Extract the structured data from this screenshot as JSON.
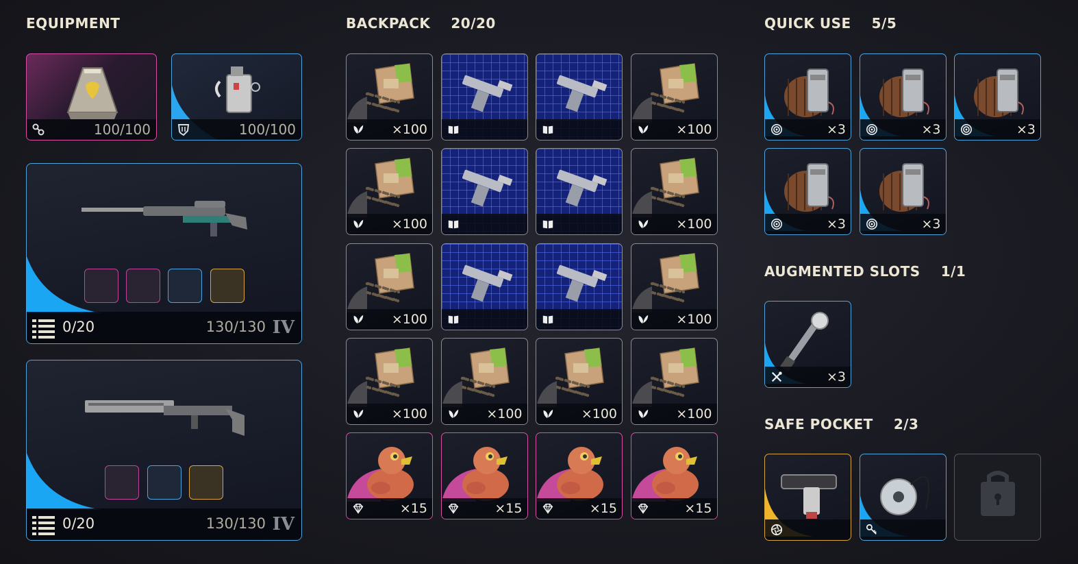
{
  "sections": {
    "equipment": {
      "title": "EQUIPMENT"
    },
    "backpack": {
      "title": "BACKPACK",
      "count": "20/20"
    },
    "quick_use": {
      "title": "QUICK USE",
      "count": "5/5"
    },
    "augmented": {
      "title": "AUGMENTED SLOTS",
      "count": "1/1"
    },
    "safe_pocket": {
      "title": "SAFE POCKET",
      "count": "2/3"
    }
  },
  "equipment": {
    "augment": {
      "value": "100/100",
      "icon": "augment-icon",
      "rarity_color": "#d850a6"
    },
    "shield": {
      "value": "100/100",
      "icon": "shield-icon",
      "rarity_color": "#2aa6f0"
    }
  },
  "weapons": [
    {
      "name": "sniper-rifle",
      "ammo": "0/20",
      "durability": "130/130",
      "tier": "IV",
      "attachments": [
        "pink",
        "pink",
        "blue",
        "gold"
      ]
    },
    {
      "name": "long-rifle",
      "ammo": "0/20",
      "durability": "130/130",
      "tier": "IV",
      "attachments": [
        "pink",
        "blue",
        "gold"
      ]
    }
  ],
  "backpack": [
    {
      "kind": "seeds",
      "qty": "×100",
      "icon": "leaf-icon"
    },
    {
      "kind": "blueprint",
      "qty": "",
      "icon": "book-icon"
    },
    {
      "kind": "blueprint",
      "qty": "",
      "icon": "book-icon"
    },
    {
      "kind": "seeds",
      "qty": "×100",
      "icon": "leaf-icon"
    },
    {
      "kind": "seeds",
      "qty": "×100",
      "icon": "leaf-icon"
    },
    {
      "kind": "blueprint",
      "qty": "",
      "icon": "book-icon"
    },
    {
      "kind": "blueprint",
      "qty": "",
      "icon": "book-icon"
    },
    {
      "kind": "seeds",
      "qty": "×100",
      "icon": "leaf-icon"
    },
    {
      "kind": "seeds",
      "qty": "×100",
      "icon": "leaf-icon"
    },
    {
      "kind": "blueprint",
      "qty": "",
      "icon": "book-icon"
    },
    {
      "kind": "blueprint",
      "qty": "",
      "icon": "book-icon"
    },
    {
      "kind": "seeds",
      "qty": "×100",
      "icon": "leaf-icon"
    },
    {
      "kind": "seeds",
      "qty": "×100",
      "icon": "leaf-icon"
    },
    {
      "kind": "seeds",
      "qty": "×100",
      "icon": "leaf-icon"
    },
    {
      "kind": "seeds",
      "qty": "×100",
      "icon": "leaf-icon"
    },
    {
      "kind": "seeds",
      "qty": "×100",
      "icon": "leaf-icon"
    },
    {
      "kind": "duck",
      "qty": "×15",
      "icon": "gem-icon"
    },
    {
      "kind": "duck",
      "qty": "×15",
      "icon": "gem-icon"
    },
    {
      "kind": "duck",
      "qty": "×15",
      "icon": "gem-icon"
    },
    {
      "kind": "duck",
      "qty": "×15",
      "icon": "gem-icon"
    }
  ],
  "quick_use": [
    {
      "kind": "grenade",
      "qty": "×3",
      "icon": "target-icon"
    },
    {
      "kind": "grenade",
      "qty": "×3",
      "icon": "target-icon"
    },
    {
      "kind": "grenade",
      "qty": "×3",
      "icon": "target-icon"
    },
    {
      "kind": "grenade",
      "qty": "×3",
      "icon": "target-icon"
    },
    {
      "kind": "grenade",
      "qty": "×3",
      "icon": "target-icon"
    }
  ],
  "augmented": [
    {
      "kind": "tool",
      "qty": "×3",
      "icon": "tools-icon"
    }
  ],
  "safe_pocket": [
    {
      "kind": "gun-part",
      "qty": "",
      "icon": "aperture-icon",
      "rarity": "gold"
    },
    {
      "kind": "key",
      "qty": "",
      "icon": "key-icon",
      "rarity": "blue"
    },
    {
      "kind": "locked",
      "qty": "",
      "icon": "lock-icon",
      "rarity": "locked"
    }
  ],
  "colors": {
    "blue": "#2aa6f0",
    "pink": "#d850a6",
    "gray": "#8a8a90",
    "gold": "#f0b429"
  }
}
